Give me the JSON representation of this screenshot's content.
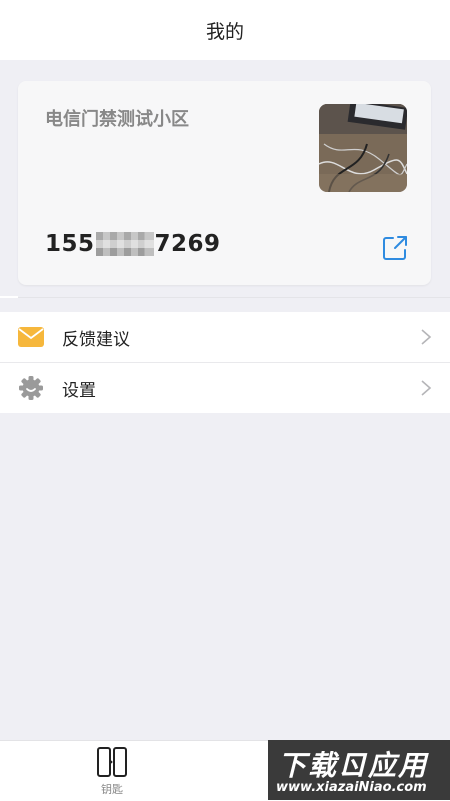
{
  "header": {
    "title": "我的"
  },
  "card": {
    "community_name": "电信门禁测试小区",
    "phone_prefix": "155",
    "phone_suffix": "7269",
    "thumbnail_icon": "photo-thumbnail",
    "share_icon": "external-link-icon"
  },
  "menu": {
    "items": [
      {
        "label": "反馈建议",
        "icon": "envelope-icon",
        "icon_color": "#f6b73c"
      },
      {
        "label": "设置",
        "icon": "gear-icon",
        "icon_color": "#9a9a9a"
      }
    ]
  },
  "tabbar": {
    "tabs": [
      {
        "label": "钥匙",
        "icon": "door-key-icon"
      }
    ]
  },
  "watermark": {
    "title": "下载ㄖ应用",
    "url": "www.xiazaiNiao.com"
  },
  "colors": {
    "accent": "#2f8be0",
    "background": "#efeff4"
  }
}
